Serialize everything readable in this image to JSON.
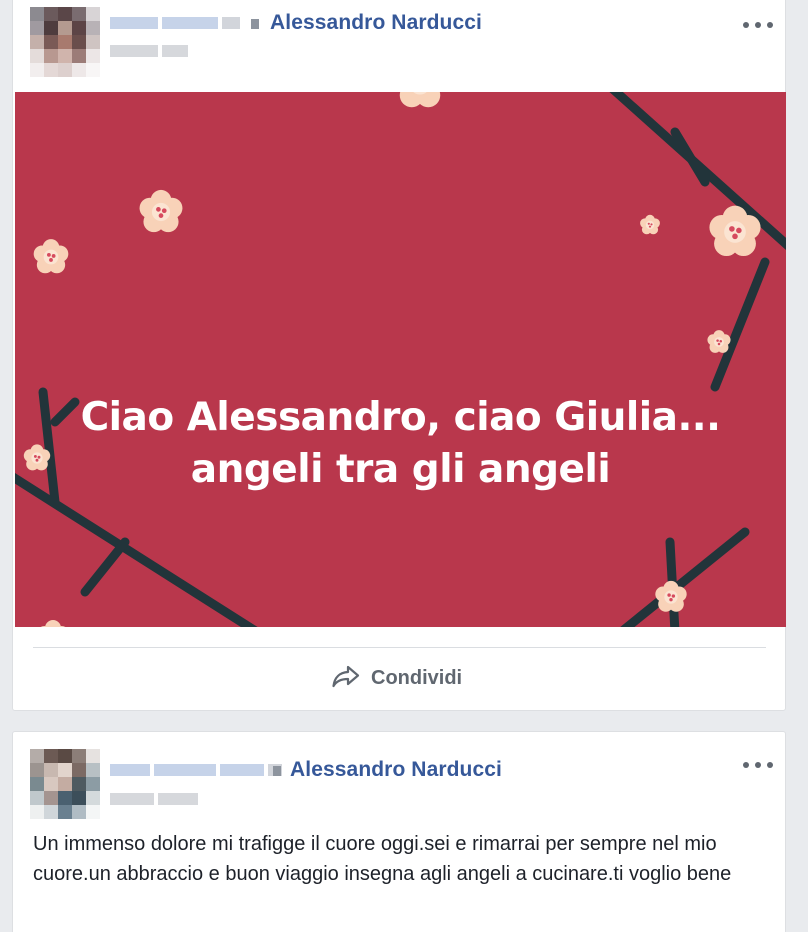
{
  "posts": [
    {
      "page_name": "Alessandro Narducci",
      "menu_icon": "more-horizontal-icon",
      "banner_text_line1": "Ciao Alessandro, ciao Giulia...",
      "banner_text_line2": "angeli tra gli angeli",
      "share_label": "Condividi",
      "share_icon": "share-arrow-icon",
      "banner_color": "#b9374c"
    },
    {
      "page_name": "Alessandro Narducci",
      "menu_icon": "more-horizontal-icon",
      "body_text": "Un immenso dolore mi trafigge il cuore oggi.sei e rimarrai per sempre nel mio cuore.un abbraccio e buon viaggio insegna agli angeli a cucinare.ti voglio bene"
    }
  ],
  "colors": {
    "link": "#365899",
    "text": "#1d2129",
    "muted": "#606770",
    "background": "#e9ebee"
  }
}
